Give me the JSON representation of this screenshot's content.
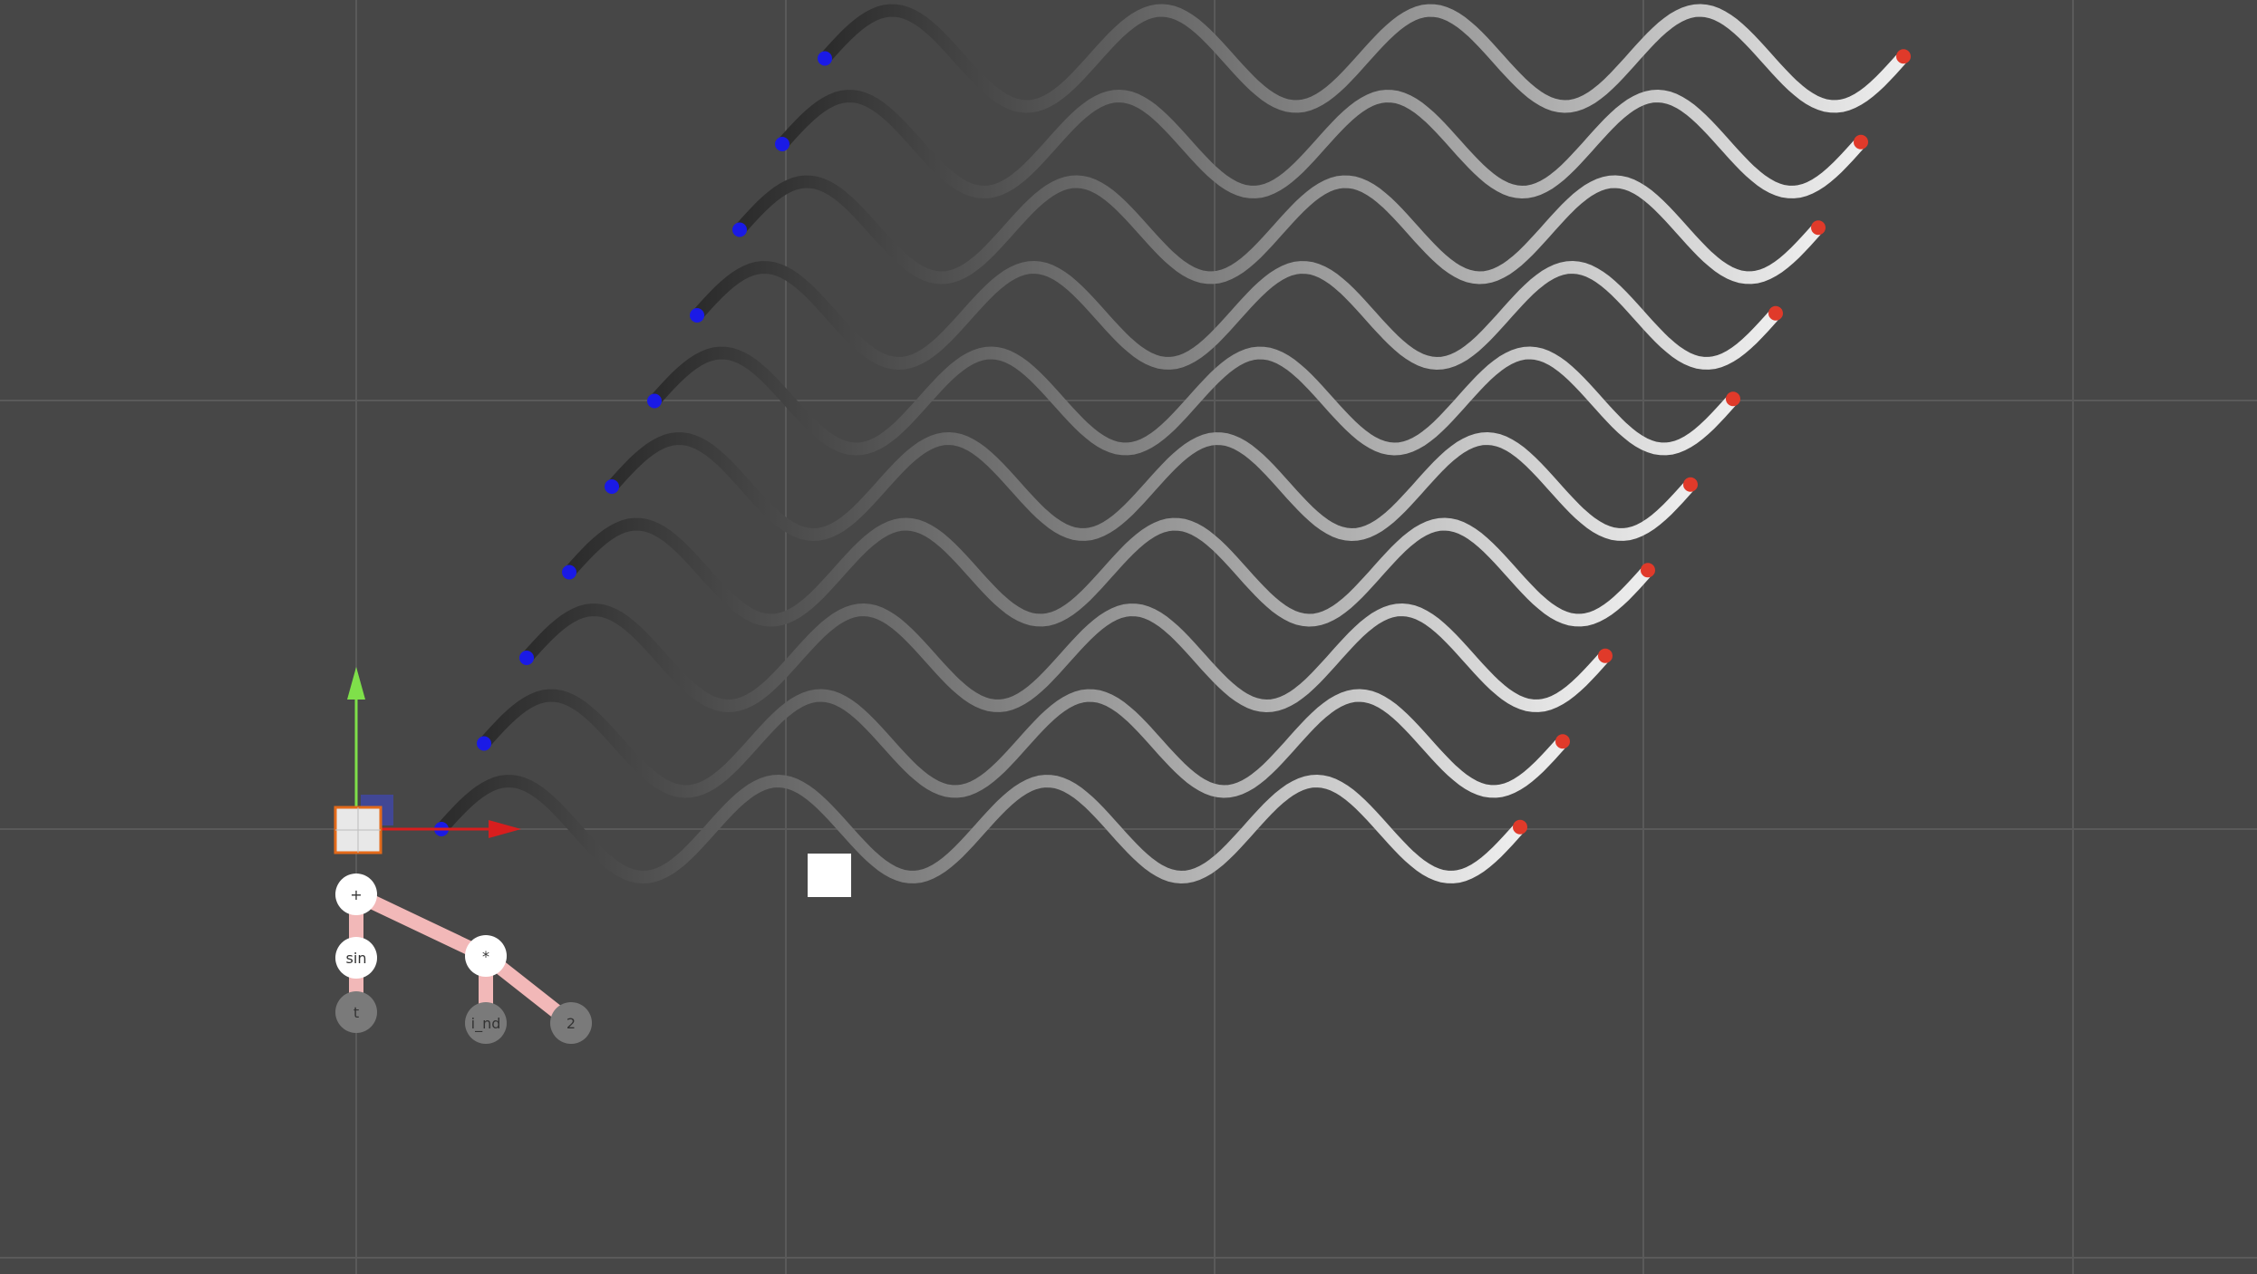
{
  "scene": {
    "background_color": "#474747",
    "grid_color": "#5a5a5a",
    "x_axis_color": "#d81e1e",
    "y_axis_color": "#7fe04a",
    "origin_handle_color": "#e36a1a",
    "wave_start_color": "#2b2b2b",
    "wave_end_color": "#eeeeee",
    "wave_start_cap_color": "#1a1ae6",
    "wave_end_cap_color": "#e03a2a",
    "wave_count": 10,
    "selected_object": "white-square",
    "icons": [
      "move-x-arrow-icon",
      "move-y-arrow-icon",
      "origin-handle-icon"
    ]
  },
  "expression_tree": {
    "nodes": [
      {
        "id": "root",
        "label": "+"
      },
      {
        "id": "sin",
        "label": "sin"
      },
      {
        "id": "mul",
        "label": "*"
      },
      {
        "id": "t",
        "label": "t"
      },
      {
        "id": "i_nd",
        "label": "i_nd"
      },
      {
        "id": "two",
        "label": "2"
      }
    ],
    "edges": [
      [
        "root",
        "sin"
      ],
      [
        "root",
        "mul"
      ],
      [
        "sin",
        "t"
      ],
      [
        "mul",
        "i_nd"
      ],
      [
        "mul",
        "two"
      ]
    ],
    "edge_color": "#f2b8b8"
  }
}
